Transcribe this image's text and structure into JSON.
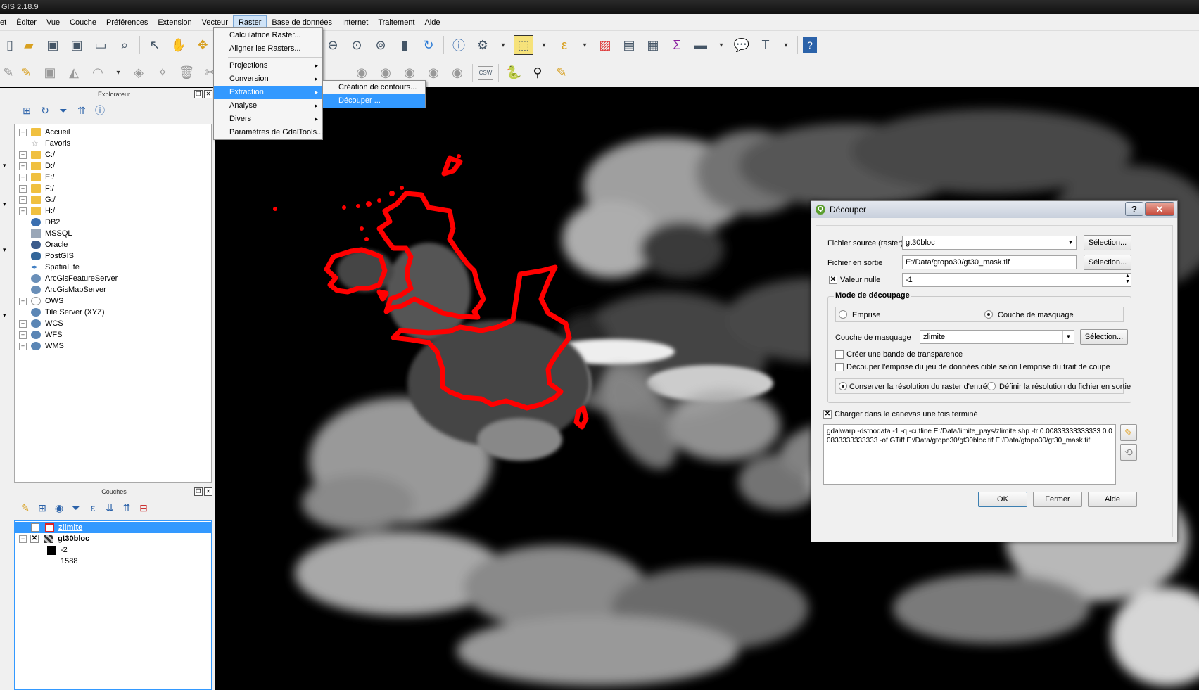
{
  "app": {
    "title": "GIS 2.18.9"
  },
  "menubar": [
    "et",
    "Éditer",
    "Vue",
    "Couche",
    "Préférences",
    "Extension",
    "Vecteur",
    "Raster",
    "Base de données",
    "Internet",
    "Traitement",
    "Aide"
  ],
  "raster_menu": {
    "items": [
      "Calculatrice Raster...",
      "Aligner les Rasters...",
      "Projections",
      "Conversion",
      "Extraction",
      "Analyse",
      "Divers",
      "Paramètres de GdalTools..."
    ],
    "extraction_submenu": [
      "Création de contours...",
      "Découper ..."
    ]
  },
  "toolbar2": {
    "csw_label": "CSW"
  },
  "explorer": {
    "title": "Explorateur",
    "items": [
      "Accueil",
      "Favoris",
      "C:/",
      "D:/",
      "E:/",
      "F:/",
      "G:/",
      "H:/",
      "DB2",
      "MSSQL",
      "Oracle",
      "PostGIS",
      "SpatiaLite",
      "ArcGisFeatureServer",
      "ArcGisMapServer",
      "OWS",
      "Tile Server (XYZ)",
      "WCS",
      "WFS",
      "WMS"
    ]
  },
  "layers": {
    "title": "Couches",
    "items": [
      {
        "name": "zlimite",
        "checked": "✕"
      },
      {
        "name": "gt30bloc",
        "checked": "✕"
      }
    ],
    "legend": [
      "-2",
      "1588"
    ]
  },
  "dialog": {
    "title": "Découper",
    "help": "?",
    "close": "✕",
    "source_label": "Fichier source (raster)",
    "source_value": "gt30bloc",
    "output_label": "Fichier en sortie",
    "output_value": "E:/Data/gtopo30/gt30_mask.tif",
    "select_button": "Sélection...",
    "nodata_label": "Valeur nulle",
    "nodata_value": "-1",
    "check_mark": "✕",
    "mode_title": "Mode de découpage",
    "mode_extent": "Emprise",
    "mode_mask": "Couche de masquage",
    "mask_layer_label": "Couche de masquage",
    "mask_layer_value": "zlimite",
    "transparency": "Créer une bande de transparence",
    "crop_extent": "Découper l'emprise du jeu de données cible selon l'emprise du trait de coupe",
    "keep_resolution": "Conserver la résolution du raster d'entrée",
    "set_resolution": "Définir la résolution du fichier en sortie",
    "load_canvas": "Charger dans le canevas une fois terminé",
    "command": "gdalwarp -dstnodata -1 -q -cutline E:/Data/limite_pays/zlimite.shp -tr 0.00833333333333 0.00833333333333 -of GTiff E:/Data/gtopo30/gt30bloc.tif E:/Data/gtopo30/gt30_mask.tif",
    "ok": "OK",
    "close_button": "Fermer",
    "help_button": "Aide"
  },
  "colors": {
    "mask_outline": "#ff0000",
    "selection": "#3399ff",
    "raster_high": "#ffffff",
    "raster_low": "#000000"
  }
}
